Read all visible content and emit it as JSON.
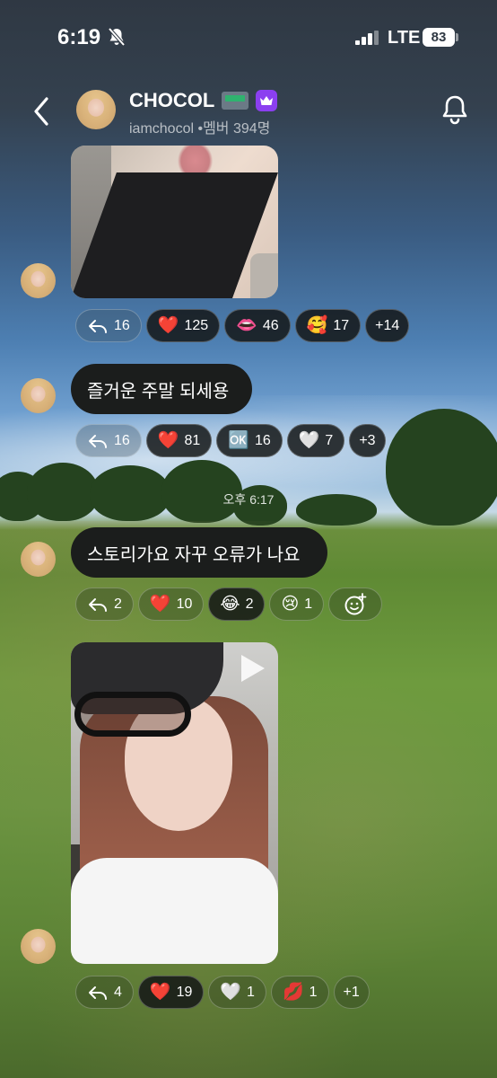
{
  "status_bar": {
    "time": "6:19",
    "network": "LTE",
    "battery": "83"
  },
  "header": {
    "title": "CHOCOL",
    "subtitle": "iamchocol •멤버 394명"
  },
  "messages": [
    {
      "type": "photo",
      "reactions": [
        {
          "kind": "reply",
          "count": "16"
        },
        {
          "emoji": "❤️",
          "count": "125"
        },
        {
          "emoji": "👄",
          "count": "46"
        },
        {
          "emoji": "🥰",
          "count": "17"
        },
        {
          "kind": "more",
          "label": "+14"
        }
      ]
    },
    {
      "type": "text",
      "text": "즐거운 주말 되세용",
      "reactions": [
        {
          "kind": "reply",
          "count": "16"
        },
        {
          "emoji": "❤️",
          "count": "81"
        },
        {
          "emoji": "🆗",
          "count": "16"
        },
        {
          "emoji": "🤍",
          "count": "7"
        },
        {
          "kind": "more",
          "label": "+3"
        }
      ]
    },
    {
      "type": "text",
      "timestamp": "오후 6:17",
      "text": "스토리가요 자꾸 오류가 나요",
      "reactions": [
        {
          "kind": "reply",
          "count": "2"
        },
        {
          "emoji": "❤️",
          "count": "10"
        },
        {
          "emoji": "😂",
          "count": "2"
        },
        {
          "emoji": "😢",
          "count": "1"
        },
        {
          "kind": "add"
        }
      ]
    },
    {
      "type": "video",
      "reactions": [
        {
          "kind": "reply",
          "count": "4"
        },
        {
          "emoji": "❤️",
          "count": "19"
        },
        {
          "emoji": "🤍",
          "count": "1"
        },
        {
          "emoji": "💋",
          "count": "1"
        },
        {
          "kind": "more",
          "label": "+1"
        }
      ]
    }
  ]
}
